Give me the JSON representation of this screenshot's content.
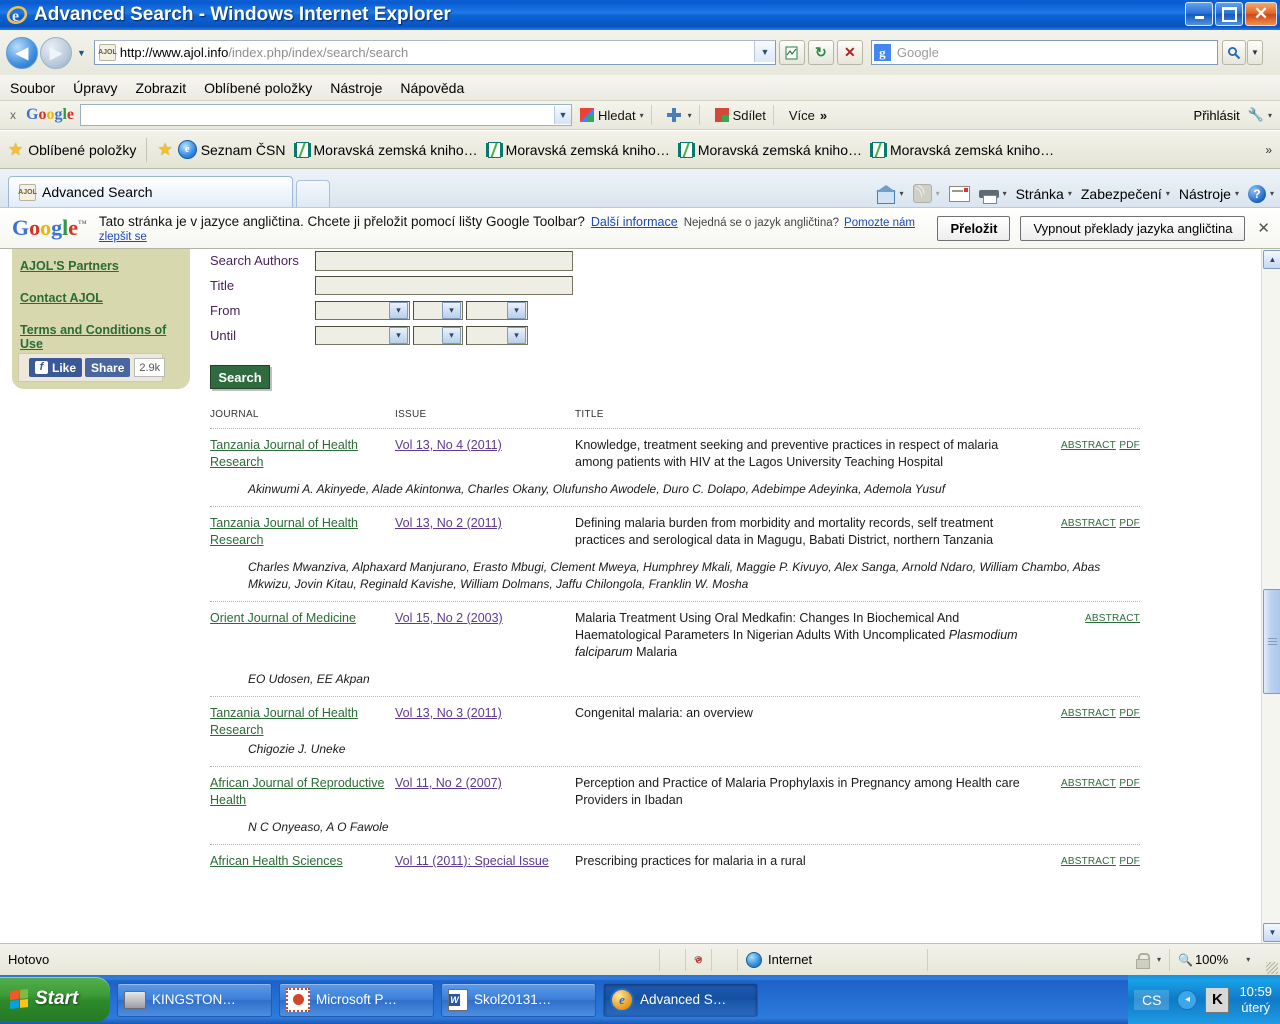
{
  "window": {
    "title": "Advanced Search - Windows Internet Explorer",
    "minimize": "_",
    "maximize": "❐",
    "close": "✕"
  },
  "address": {
    "url_host": "http://www.ajol.info",
    "url_path": "/index.php/index/search/search",
    "favicon": "ajol-favicon-icon",
    "back": "◀",
    "forward": "▶",
    "history_dropdown": "▼",
    "compat_view": "compatibility-view-icon",
    "refresh": "↻",
    "stop": "✕",
    "search_placeholder": "Google",
    "search_go": "⚲",
    "search_options": "▼"
  },
  "menu": {
    "items": [
      "Soubor",
      "Úpravy",
      "Zobrazit",
      "Oblíbené položky",
      "Nástroje",
      "Nápověda"
    ]
  },
  "google_toolbar": {
    "close": "x",
    "logo": [
      "G",
      "o",
      "o",
      "g",
      "l",
      "e"
    ],
    "input_value": "",
    "search_label": "Hledat",
    "plus_label": "",
    "share_label": "Sdílet",
    "more_label": "Více",
    "more_chevron": "»",
    "signin_label": "Přihlásit",
    "settings_icon": "wrench-icon",
    "caret": "▾"
  },
  "favorites": {
    "label": "Oblíbené položky",
    "items": [
      {
        "label": "Seznam ČSN",
        "icon": "ie-icon"
      },
      {
        "label": "Moravská zemská kniho…",
        "icon": "mzk-icon"
      },
      {
        "label": "Moravská zemská kniho…",
        "icon": "mzk-icon"
      },
      {
        "label": "Moravská zemská kniho…",
        "icon": "mzk-icon"
      },
      {
        "label": "Moravská zemská kniho…",
        "icon": "mzk-icon"
      }
    ],
    "overflow": "»"
  },
  "tabs": {
    "active": "Advanced Search",
    "new_tab": ""
  },
  "command_bar": {
    "home": "",
    "feeds": "",
    "mail": "",
    "print": "",
    "page": "Stránka",
    "safety": "Zabezpečení",
    "tools": "Nástroje",
    "help": "?",
    "caret": "▾",
    "overflow": "»"
  },
  "translate_bar": {
    "logo": [
      "G",
      "o",
      "o",
      "g",
      "l",
      "e"
    ],
    "tm": "™",
    "message": "Tato stránka je v jazyce angličtina. Chcete ji přeložit pomocí lišty Google Toolbar?",
    "more_info": "Další informace",
    "not_english": "Nejedná se o jazyk angličtina?",
    "help_us": "Pomozte nám",
    "improve": "zlepšit se",
    "translate_button": "Přeložit",
    "turn_off_button": "Vypnout překlady jazyka angličtina",
    "close": "✕"
  },
  "sidebar": {
    "links": [
      "AJOL'S Partners",
      "Contact AJOL",
      "Terms and Conditions of Use"
    ],
    "facebook": {
      "like": "Like",
      "share": "Share",
      "count": "2.9k",
      "f_glyph": "f"
    }
  },
  "search_form": {
    "rows": [
      {
        "label": "Search Authors",
        "type": "text",
        "value": ""
      },
      {
        "label": "Title",
        "type": "text",
        "value": ""
      },
      {
        "label": "From",
        "type": "selects",
        "value": ""
      },
      {
        "label": "Until",
        "type": "selects",
        "value": ""
      }
    ],
    "submit": "Search",
    "select_arrow": "▾"
  },
  "results": {
    "headers": [
      "JOURNAL",
      "ISSUE",
      "TITLE"
    ],
    "rows": [
      {
        "journal": "Tanzania Journal of Health Research",
        "issue": "Vol 13, No 4 (2011)",
        "title": "Knowledge, treatment seeking and preventive practices in respect of malaria among patients with HIV at the Lagos University Teaching Hospital",
        "links": [
          "ABSTRACT",
          "PDF"
        ],
        "authors": "Akinwumi A. Akinyede, Alade Akintonwa, Charles Okany, Olufunsho Awodele, Duro C. Dolapo, Adebimpe Adeyinka, Ademola Yusuf"
      },
      {
        "journal": "Tanzania Journal of Health Research",
        "issue": "Vol 13, No 2 (2011)",
        "title": "Defining malaria burden from morbidity and mortality records, self treatment practices and serological data in Magugu, Babati District, northern Tanzania",
        "links": [
          "ABSTRACT",
          "PDF"
        ],
        "authors": "Charles Mwanziva, Alphaxard Manjurano, Erasto Mbugi, Clement Mweya, Humphrey Mkali, Maggie P. Kivuyo, Alex Sanga, Arnold Ndaro, William Chambo, Abas Mkwizu, Jovin Kitau, Reginald Kavishe, William Dolmans, Jaffu Chilongola, Franklin W. Mosha"
      },
      {
        "journal": "Orient Journal of Medicine",
        "issue": "Vol 15, No 2 (2003)",
        "title_pre": "Malaria Treatment Using Oral Medkafin: Changes In Biochemical And Haematological Parameters In Nigerian Adults With Uncomplicated ",
        "title_italic": "Plasmodium falciparum",
        "title_post": " Malaria",
        "links": [
          "ABSTRACT"
        ],
        "authors": "EO Udosen, EE Akpan"
      },
      {
        "journal": "Tanzania Journal of Health Research",
        "issue": "Vol 13, No 3 (2011)",
        "title": "Congenital malaria: an overview",
        "links": [
          "ABSTRACT",
          "PDF"
        ],
        "authors": "Chigozie J. Uneke"
      },
      {
        "journal": "African Journal of Reproductive Health",
        "issue": "Vol 11, No 2 (2007)",
        "title": "Perception and Practice of Malaria Prophylaxis in Pregnancy among Health care Providers in Ibadan",
        "links": [
          "ABSTRACT",
          "PDF"
        ],
        "authors": "N C Onyeaso, A O Fawole"
      },
      {
        "journal": "African Health Sciences",
        "issue": "Vol 11 (2011): Special Issue",
        "title": "Prescribing practices for malaria in a rural",
        "links": [
          "ABSTRACT",
          "PDF"
        ],
        "authors": ""
      }
    ]
  },
  "status_bar": {
    "text": "Hotovo",
    "zone": "Internet",
    "zoom": "100%",
    "zoom_caret": "▾",
    "protected_caret": "▾"
  },
  "taskbar": {
    "start": "Start",
    "buttons": [
      {
        "label": "KINGSTON…",
        "icon": "usb-drive-icon",
        "active": false
      },
      {
        "label": "Microsoft P…",
        "icon": "powerpoint-icon",
        "active": false
      },
      {
        "label": "Skol20131…",
        "icon": "word-icon",
        "active": false
      },
      {
        "label": "Advanced S…",
        "icon": "ie-icon",
        "active": true
      }
    ],
    "language": "CS",
    "tray_chevron": "◂",
    "tray_icon": "K",
    "time": "10:59",
    "day": "úterý"
  },
  "colors": {
    "title_blue": "#0a5ad0",
    "link_green": "#2b6b37",
    "link_purple": "#5d3a8e",
    "sidebar_tan": "#d8d8ae",
    "search_button_green": "#2f6b3e"
  }
}
